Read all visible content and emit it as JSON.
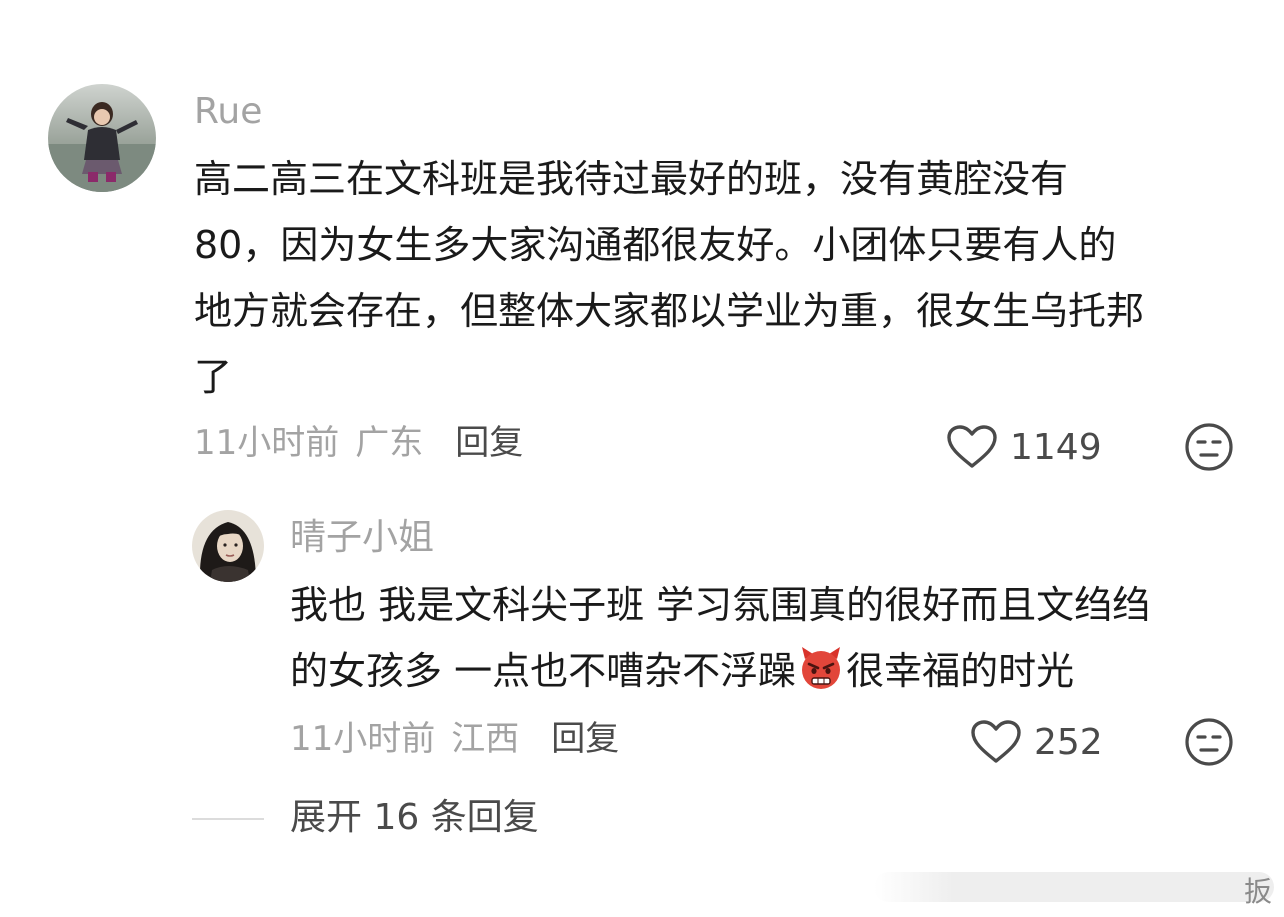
{
  "comments": [
    {
      "username": "Rue",
      "lines": [
        "高二高三在文科班是我待过最好的班，没有黄腔没有",
        " 80，因为女生多大家沟通都很友好。小团体只要有人的",
        "地方就会存在，但整体大家都以学业为重，很女生乌托邦",
        "了"
      ],
      "time": "11小时前",
      "location": "广东",
      "reply_label": "回复",
      "likes": "1149",
      "avatar_icon": "child-photo-avatar"
    }
  ],
  "reply": {
    "username": "晴子小姐",
    "line1": "我也  我是文科尖子班 学习氛围真的很好而且文绉绉",
    "line2_before": "的女孩多 一点也不嘈杂不浮躁",
    "line2_emoji": "angry-devil-emoji",
    "line2_after": "很幸福的时光",
    "time": "11小时前",
    "location": "江西",
    "reply_label": "回复",
    "likes": "252",
    "avatar_icon": "woman-photo-avatar"
  },
  "expand_label": "展开 16 条回复",
  "watermark_text": "扳",
  "colors": {
    "username": "#a3a3a3",
    "text": "#1a1a1a",
    "meta": "#a3a3a3",
    "action": "#4a4a4a"
  }
}
